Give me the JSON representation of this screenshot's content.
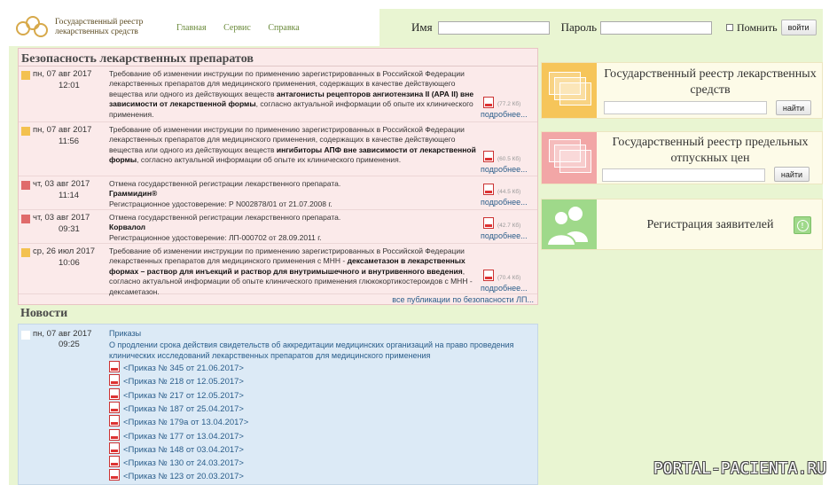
{
  "header": {
    "logo_line1": "Государственный реестр",
    "logo_line2": "лекарственных средств",
    "nav": [
      "Главная",
      "Сервис",
      "Справка"
    ],
    "name_label": "Имя",
    "password_label": "Пароль",
    "remember_label": "Помнить",
    "login_button": "войти"
  },
  "safety": {
    "title": "Безопасность лекарственных препаратов",
    "all_link": "все публикации по безопасности ЛП...",
    "entries": [
      {
        "date": "пн, 07 авг 2017",
        "time": "12:01",
        "marker": "#f3c14f",
        "text_a": "Требование об изменении инструкции по применению зарегистрированных в Российской Федерации лекарственных препаратов для медицинского применения, содержащих в качестве действующего вещества или одного из действующих веществ ",
        "bold": "антагонисты рецепторов ангиотензина II (АРА II) вне зависимости от лекарственной формы",
        "text_b": ", согласно актуальной информации об опыте их клинического применения.",
        "size": "(77.2 Кб)",
        "more": "подробнее..."
      },
      {
        "date": "пн, 07 авг 2017",
        "time": "11:56",
        "marker": "#f3c14f",
        "text_a": "Требование об изменении инструкции по применению зарегистрированных в Российской Федерации лекарственных препаратов для медицинского применения, содержащих в качестве действующего вещества или одного из действующих веществ ",
        "bold": "ингибиторы АПФ вне зависимости от лекарственной формы",
        "text_b": ", согласно актуальной информации об опыте их клинического применения.",
        "size": "(60.5 Кб)",
        "more": "подробнее..."
      },
      {
        "date": "чт, 03 авг 2017",
        "time": "11:14",
        "marker": "#e06b6b",
        "text_a": "Отмена государственной регистрации лекарственного препарата.",
        "bold": "Граммидин®",
        "text_b": "Регистрационное удостоверение: Р N002878/01 от 21.07.2008 г.",
        "size": "(44.5 Кб)",
        "more": "подробнее..."
      },
      {
        "date": "чт, 03 авг 2017",
        "time": "09:31",
        "marker": "#e06b6b",
        "text_a": "Отмена государственной регистрации лекарственного препарата.",
        "bold": "Корвалол",
        "text_b": "Регистрационное удостоверение: ЛП-000702 от 28.09.2011 г.",
        "size": "(42.7 Кб)",
        "more": "подробнее..."
      },
      {
        "date": "ср, 26 июл 2017",
        "time": "10:06",
        "marker": "#f3c14f",
        "text_a": "Требование об изменении инструкции по применению зарегистрированных в Российской Федерации лекарственных препаратов для медицинского применения с МНН - ",
        "bold": "дексаметазон в лекарственных формах – раствор для инъекций и раствор для внутримышечного и внутривенного введения",
        "text_b": ", согласно актуальной информации об опыте клинического применения глюкокортикостероидов с МНН - дексаметазон.",
        "size": "(70.4 Кб)",
        "more": "подробнее..."
      }
    ]
  },
  "news": {
    "title": "Новости",
    "date": "пн, 07 авг 2017",
    "time": "09:25",
    "category": "Приказы",
    "headline": "О продлении срока действия свидетельств об аккредитации медицинских организаций на право проведения клинических исследований лекарственных препаратов для медицинского применения",
    "orders": [
      "<Приказ № 345 от 21.06.2017>",
      "<Приказ № 218 от 12.05.2017>",
      "<Приказ № 217 от 12.05.2017>",
      "<Приказ № 187 от 25.04.2017>",
      "<Приказ № 179а от 13.04.2017>",
      "<Приказ № 177 от 13.04.2017>",
      "<Приказ № 148 от 03.04.2017>",
      "<Приказ № 130 от 24.03.2017>",
      "<Приказ № 123 от 20.03.2017>"
    ]
  },
  "cards": [
    {
      "title": "Государственный реестр лекарственных средств",
      "button": "найти",
      "color": "#f6c55a"
    },
    {
      "title": "Государственный реестр предельных отпускных цен",
      "button": "найти",
      "color": "#f2a6a6"
    },
    {
      "title": "Регистрация заявителей",
      "color": "#9fd98a"
    }
  ],
  "watermark": "PORTAL-PACIENTA.RU"
}
